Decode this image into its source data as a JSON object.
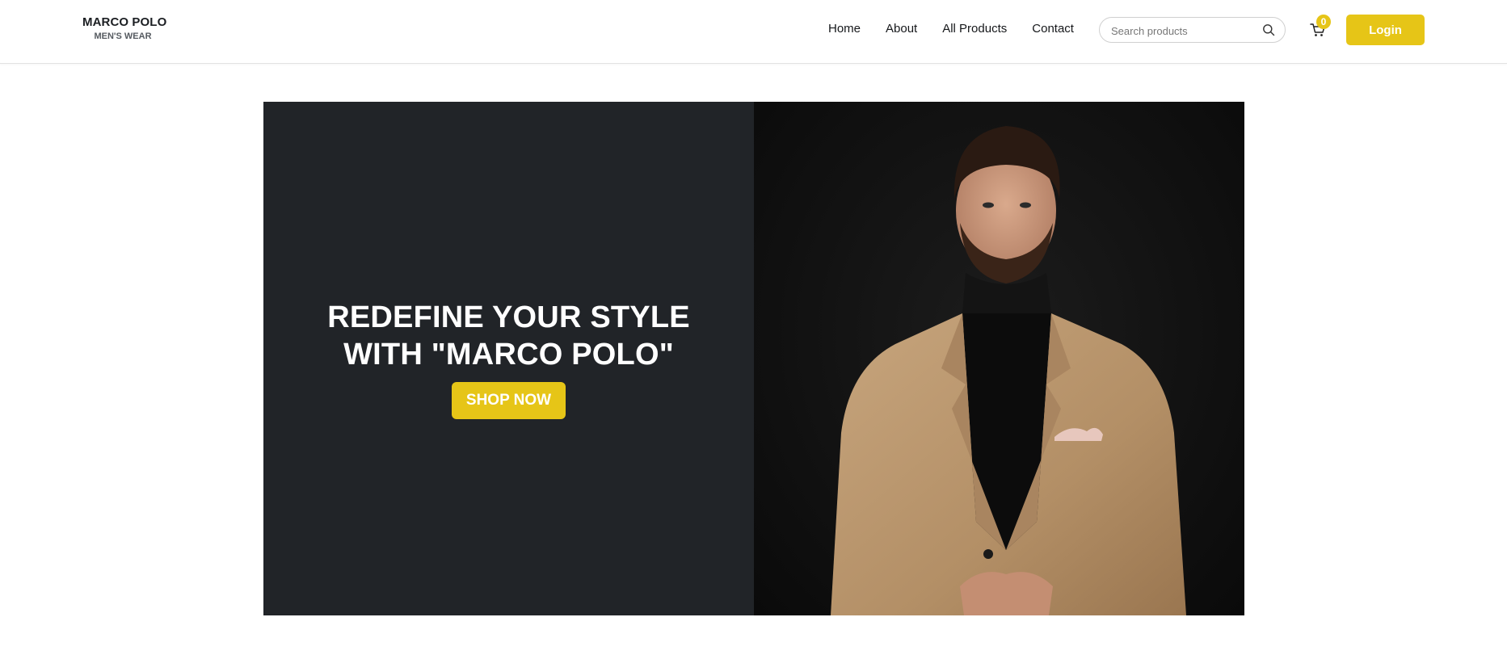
{
  "brand": {
    "name": "MARCO POLO",
    "tagline": "MEN'S WEAR"
  },
  "nav": {
    "items": [
      {
        "label": "Home"
      },
      {
        "label": "About"
      },
      {
        "label": "All Products"
      },
      {
        "label": "Contact"
      }
    ]
  },
  "search": {
    "placeholder": "Search products",
    "value": "",
    "icon": "search-icon"
  },
  "cart": {
    "count": "0",
    "icon": "cart-icon"
  },
  "login": {
    "label": "Login"
  },
  "hero": {
    "title_line1": "REDEFINE YOUR STYLE",
    "title_line2": "WITH \"MARCO POLO\"",
    "cta_label": "SHOP NOW",
    "image": "man-in-tan-blazer-photo"
  },
  "colors": {
    "accent": "#e6c517",
    "hero_dark": "#212428",
    "text_dark": "#15171a"
  }
}
